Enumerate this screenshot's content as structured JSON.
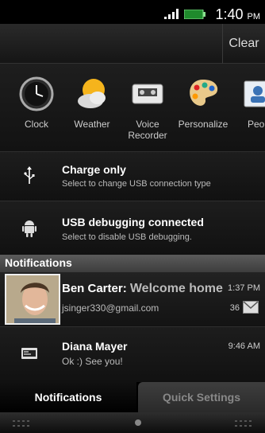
{
  "status_bar": {
    "time": "1:40",
    "ampm": "PM"
  },
  "header": {
    "clear_label": "Clear"
  },
  "apps": [
    {
      "label": "Clock",
      "icon": "clock-icon"
    },
    {
      "label": "Weather",
      "icon": "weather-icon"
    },
    {
      "label": "Voice Recorder",
      "icon": "voice-recorder-icon"
    },
    {
      "label": "Personalize",
      "icon": "palette-icon"
    },
    {
      "label": "Peop",
      "icon": "people-icon"
    }
  ],
  "ongoing": [
    {
      "title": "Charge only",
      "subtitle": "Select to change USB connection type",
      "icon": "usb-icon"
    },
    {
      "title": "USB debugging connected",
      "subtitle": "Select to disable USB debugging.",
      "icon": "android-icon"
    }
  ],
  "notifications_header": "Notifications",
  "notifications": [
    {
      "sender": "Ben Carter:",
      "message": "Welcome home",
      "account": "jsinger330@gmail.com",
      "time": "1:37 PM",
      "count": "36",
      "icon": "gmail-icon"
    },
    {
      "sender": "Diana Mayer",
      "message": "Ok :) See you!",
      "time": "9:46 AM",
      "icon": "message-icon"
    }
  ],
  "tabs": {
    "active": "Notifications",
    "inactive": "Quick Settings"
  }
}
